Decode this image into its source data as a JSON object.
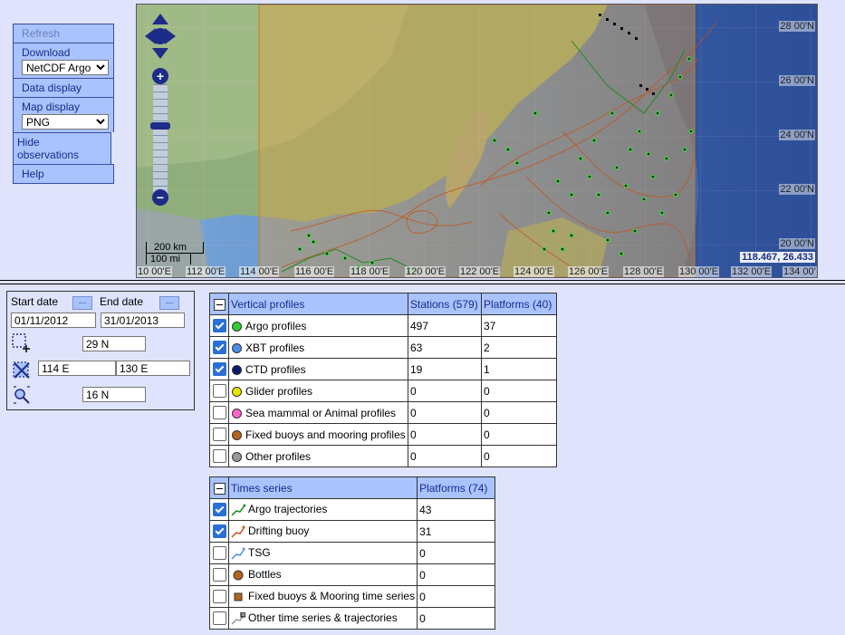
{
  "menu": {
    "refresh": "Refresh",
    "download": "Download",
    "download_format": "NetCDF Argo",
    "data_display": "Data display",
    "map_display": "Map display",
    "map_format": "PNG",
    "hide_observations": "Hide observations",
    "help": "Help"
  },
  "map": {
    "coords": "118.467, 26.433",
    "scale_km": "200 km",
    "scale_mi": "100 mi",
    "zoom_in": "+",
    "zoom_out": "−",
    "lon_labels": [
      "10 00'E",
      "112 00'E",
      "114 00'E",
      "116 00'E",
      "118 00'E",
      "120 00'E",
      "122 00'E",
      "124 00'E",
      "126 00'E",
      "128 00'E",
      "130 00'E",
      "132 00'E",
      "134 00'"
    ],
    "lat_labels": [
      "28 00'N",
      "26 00'N",
      "24 00'N",
      "22 00'N",
      "20 00'N"
    ],
    "colors": {
      "land": "#8fae7c",
      "ocean": "#3f6fb8",
      "selection": "#e0a040"
    }
  },
  "filters": {
    "start_date_label": "Start date",
    "end_date_label": "End date",
    "dots": "...",
    "start_date": "01/11/2012",
    "end_date": "31/01/2013",
    "north": "29 N",
    "west": "114 E",
    "east": "130 E",
    "south": "16 N"
  },
  "vertical_profiles": {
    "header": {
      "title": "Vertical profiles",
      "stations": "Stations (579)",
      "platforms": "Platforms (40)"
    },
    "rows": [
      {
        "label": "Argo profiles",
        "color": "#33cc33",
        "checked": true,
        "stations": "497",
        "platforms": "37"
      },
      {
        "label": "XBT profiles",
        "color": "#4a90e2",
        "checked": true,
        "stations": "63",
        "platforms": "2"
      },
      {
        "label": "CTD profiles",
        "color": "#0a1a6e",
        "checked": true,
        "stations": "19",
        "platforms": "1"
      },
      {
        "label": "Glider profiles",
        "color": "#e6e600",
        "checked": false,
        "stations": "0",
        "platforms": "0"
      },
      {
        "label": "Sea mammal or Animal profiles",
        "color": "#ff66cc",
        "checked": false,
        "stations": "0",
        "platforms": "0"
      },
      {
        "label": "Fixed buoys and mooring profiles",
        "color": "#b5651d",
        "checked": false,
        "stations": "0",
        "platforms": "0"
      },
      {
        "label": "Other profiles",
        "color": "#999999",
        "checked": false,
        "stations": "0",
        "platforms": "0"
      }
    ]
  },
  "time_series": {
    "header": {
      "title": "Times series",
      "platforms": "Platforms (74)"
    },
    "rows": [
      {
        "label": "Argo trajectories",
        "icon": "argo-trajectory-icon",
        "checked": true,
        "platforms": "43"
      },
      {
        "label": "Drifting buoy",
        "icon": "drifting-buoy-icon",
        "checked": true,
        "platforms": "31"
      },
      {
        "label": "TSG",
        "icon": "tsg-icon",
        "checked": false,
        "platforms": "0"
      },
      {
        "label": "Bottles",
        "icon": "bottle-icon",
        "checked": false,
        "platforms": "0"
      },
      {
        "label": "Fixed buoys & Mooring time series",
        "icon": "mooring-icon",
        "checked": false,
        "platforms": "0"
      },
      {
        "label": "Other time series & trajectories",
        "icon": "other-trajectory-icon",
        "checked": false,
        "platforms": "0"
      }
    ]
  }
}
